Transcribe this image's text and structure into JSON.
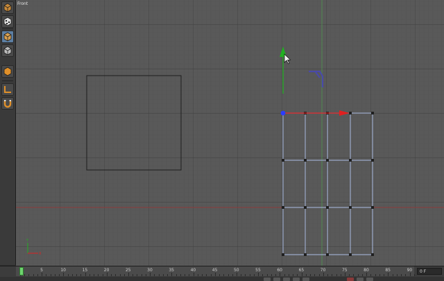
{
  "viewport": {
    "label": "Front",
    "colors": {
      "background": "#595959",
      "grid_minor": "#525252",
      "grid_major": "#3f3f3f",
      "x_axis": "#8b3a3a",
      "y_axis": "#4f8a4f",
      "spline": "#9aa9c8",
      "point": "#1f1f1f",
      "gizmo_x": "#e02020",
      "gizmo_y": "#22b022",
      "gizmo_start": "#2b3cff",
      "camera_marker": "#4a4aa8"
    }
  },
  "toolbar": {
    "tools": [
      {
        "name": "cube-tool-icon"
      },
      {
        "name": "checker-cube-icon"
      },
      {
        "name": "model-mode-icon",
        "active": true
      },
      {
        "name": "object-mode-icon"
      },
      {
        "name": "texture-mode-icon"
      },
      {
        "name": "axis-mode-icon"
      },
      {
        "name": "magnet-icon"
      }
    ]
  },
  "timeline": {
    "ticks": [
      "5",
      "10",
      "15",
      "20",
      "25",
      "30",
      "35",
      "40",
      "45",
      "50",
      "55",
      "60",
      "65",
      "70",
      "75",
      "80",
      "85",
      "90"
    ],
    "current_frame": "0 F"
  }
}
